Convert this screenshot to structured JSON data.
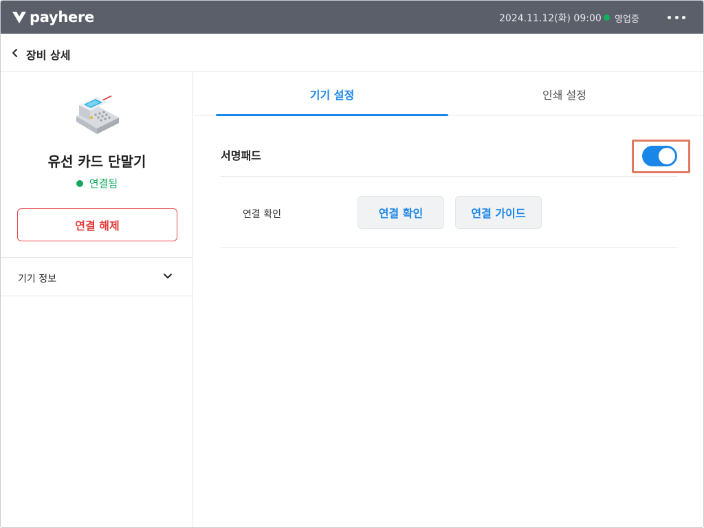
{
  "topbar": {
    "logo_text": "payhere",
    "datetime": "2024.11.12(화) 09:00",
    "store_status": "영업중",
    "status_color": "#14b05c",
    "more_icon": "more-horizontal-icon"
  },
  "header": {
    "back_icon": "chevron-left-icon",
    "title": "장비 상세"
  },
  "device": {
    "image_icon": "card-terminal-icon",
    "name": "유선 카드 단말기",
    "status": "연결됨",
    "status_color": "#14a860",
    "disconnect_label": "연결 해제",
    "info_label": "기기 정보"
  },
  "tabs": [
    {
      "label": "기기 설정",
      "active": true
    },
    {
      "label": "인쇄 설정",
      "active": false
    }
  ],
  "settings": {
    "signpad_label": "서명패드",
    "signpad_enabled": true,
    "check_label": "연결 확인",
    "check_button": "연결 확인",
    "guide_button": "연결 가이드"
  },
  "colors": {
    "accent": "#1a86e8",
    "danger": "#e23c3c",
    "highlight": "#e07a5f",
    "topbar": "#5b5f6a"
  }
}
